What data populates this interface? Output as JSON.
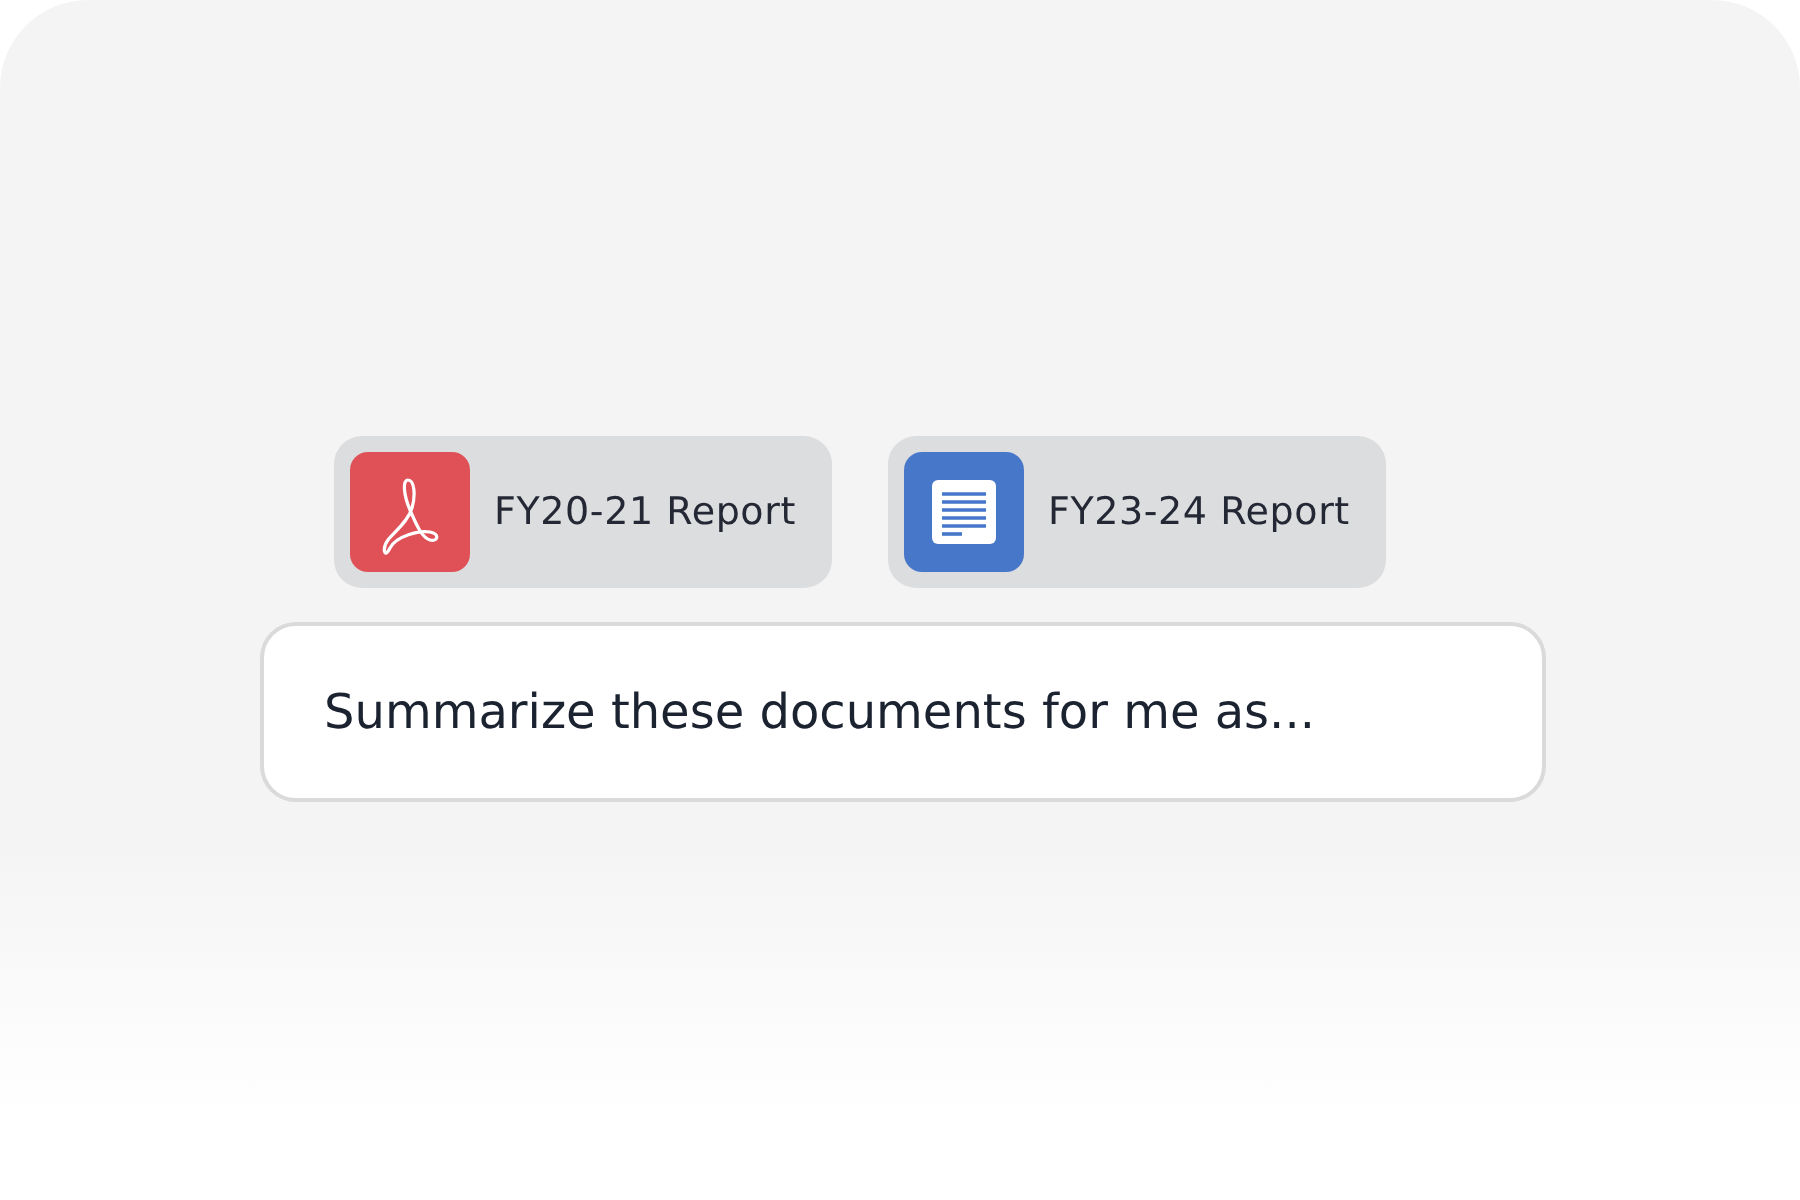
{
  "attachments": [
    {
      "kind": "pdf",
      "label": "FY20-21 Report"
    },
    {
      "kind": "doc",
      "label": "FY23-24 Report"
    }
  ],
  "prompt": {
    "value": "Summarize these documents for me as..."
  }
}
